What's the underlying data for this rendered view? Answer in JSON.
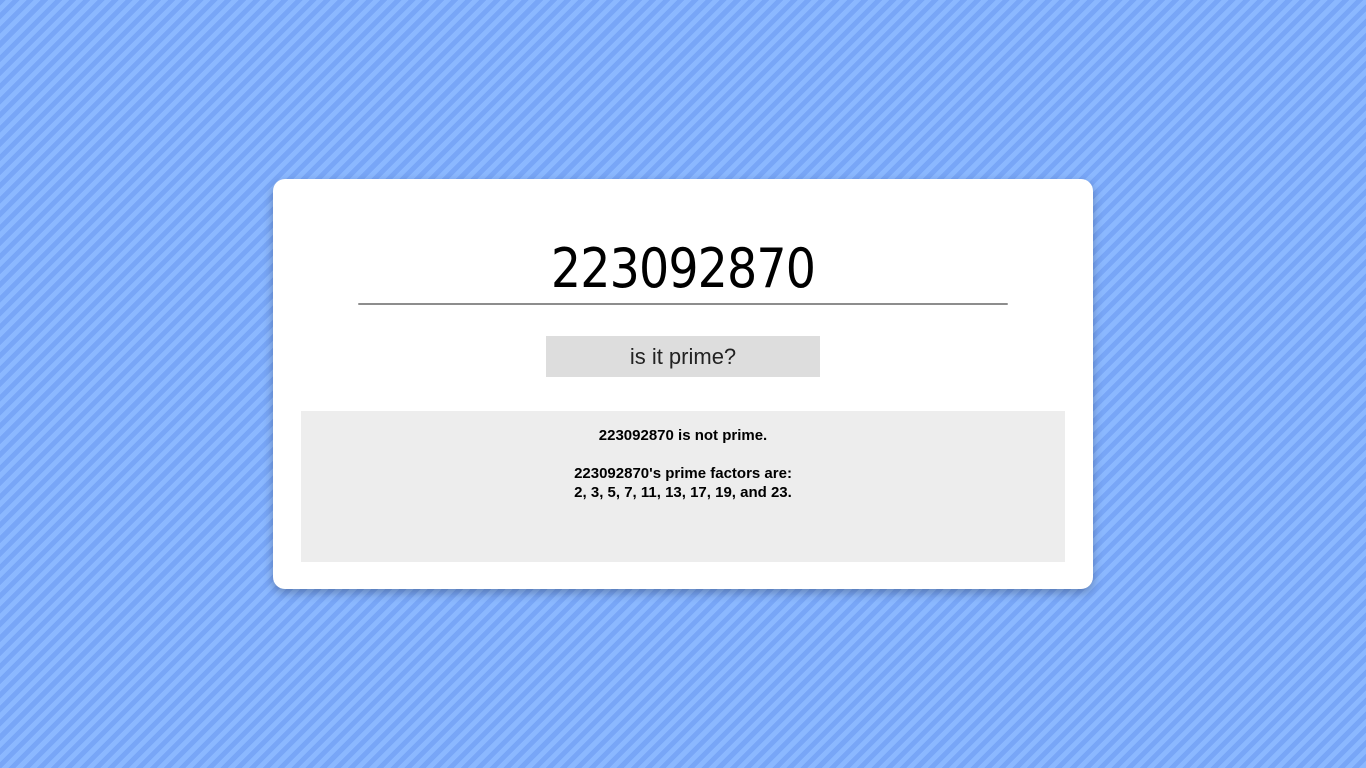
{
  "input": {
    "value": "223092870"
  },
  "button": {
    "label": "is it prime?"
  },
  "result": {
    "verdict": "223092870 is not prime.",
    "factors_heading": "223092870's prime factors are:",
    "factors_list": "2, 3, 5, 7, 11, 13, 17, 19, and 23."
  },
  "colors": {
    "background_stripe_light": "#8bb8ff",
    "background_stripe_dark": "#78a6f7",
    "card": "#ffffff",
    "button": "#dddddd",
    "result_panel": "#ededed"
  }
}
